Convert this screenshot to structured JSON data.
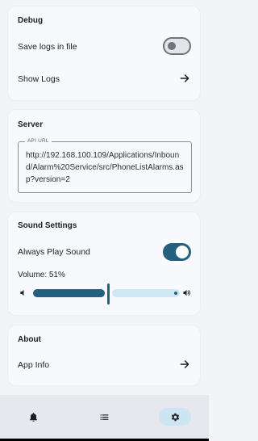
{
  "debug": {
    "title": "Debug",
    "save_logs_label": "Save logs in file",
    "save_logs_enabled": false,
    "show_logs_label": "Show Logs"
  },
  "server": {
    "title": "Server",
    "api_url_label": "API URL",
    "api_url_value": "http://192.168.100.109/Applications/Inbound/Alarm%20Service/src/PhoneListAlarms.asp?version=2"
  },
  "sound": {
    "title": "Sound Settings",
    "always_play_label": "Always Play Sound",
    "always_play_enabled": true,
    "volume_label": "Volume: 51%",
    "volume_value": 0.51
  },
  "about": {
    "title": "About",
    "app_info_label": "App Info"
  },
  "nav": {
    "selected": "settings",
    "items": [
      {
        "id": "alarms",
        "icon": "bell-icon"
      },
      {
        "id": "list",
        "icon": "list-icon"
      },
      {
        "id": "settings",
        "icon": "gear-icon"
      }
    ]
  },
  "colors": {
    "accent": "#24607e",
    "accent_light": "#cfe6f3",
    "background": "#f2f4f8",
    "card": "#f8f9fd"
  }
}
